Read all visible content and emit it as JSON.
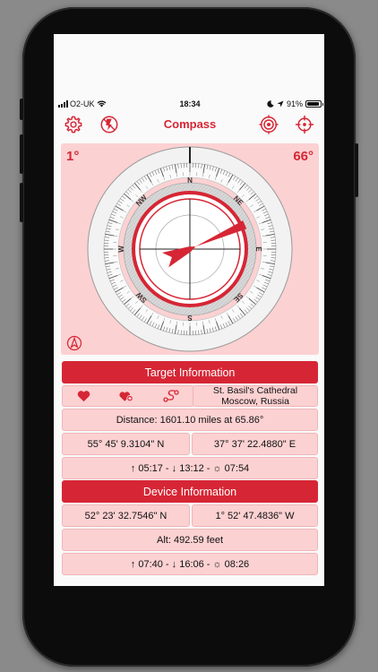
{
  "status": {
    "carrier": "O2-UK",
    "time": "18:34",
    "battery": "91%"
  },
  "nav": {
    "title": "Compass"
  },
  "compass": {
    "left_degree": "1°",
    "right_degree": "66°",
    "heading": 66,
    "cardinals": {
      "n": "N",
      "ne": "NE",
      "e": "E",
      "se": "SE",
      "s": "S",
      "sw": "SW",
      "w": "W",
      "nw": "NW"
    },
    "accent": "#d62635"
  },
  "target": {
    "header": "Target Information",
    "name_line1": "St. Basil's Cathedral",
    "name_line2": "Moscow, Russia",
    "distance": "Distance: 1601.10 miles at 65.86°",
    "latitude": "55° 45' 9.3104\" N",
    "longitude": "37° 37' 22.4880\" E",
    "sun_times": "↑ 05:17 - ↓ 13:12 - ☼ 07:54"
  },
  "device": {
    "header": "Device Information",
    "latitude": "52° 23' 32.7546\" N",
    "longitude": "1° 52' 47.4836\" W",
    "altitude": "Alt: 492.59 feet",
    "sun_times": "↑ 07:40 - ↓ 16:06 - ☼ 08:26"
  }
}
